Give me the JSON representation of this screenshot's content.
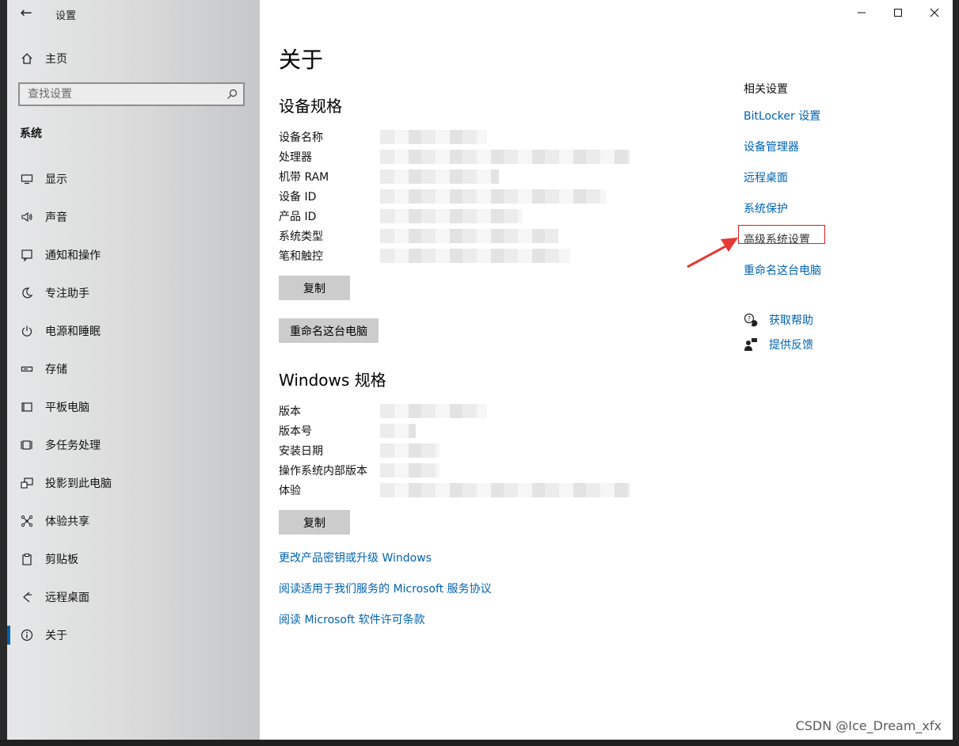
{
  "titlebar": {
    "title": "设置"
  },
  "sidebar": {
    "home_label": "主页",
    "search_placeholder": "查找设置",
    "section": "系统",
    "items": [
      {
        "label": "显示",
        "icon": "monitor-icon"
      },
      {
        "label": "声音",
        "icon": "speaker-icon"
      },
      {
        "label": "通知和操作",
        "icon": "notification-icon"
      },
      {
        "label": "专注助手",
        "icon": "moon-icon"
      },
      {
        "label": "电源和睡眠",
        "icon": "power-icon"
      },
      {
        "label": "存储",
        "icon": "storage-icon"
      },
      {
        "label": "平板电脑",
        "icon": "tablet-icon"
      },
      {
        "label": "多任务处理",
        "icon": "multitask-icon"
      },
      {
        "label": "投影到此电脑",
        "icon": "project-icon"
      },
      {
        "label": "体验共享",
        "icon": "share-icon"
      },
      {
        "label": "剪贴板",
        "icon": "clipboard-icon"
      },
      {
        "label": "远程桌面",
        "icon": "remote-icon"
      },
      {
        "label": "关于",
        "icon": "info-icon"
      }
    ],
    "active_index": 12
  },
  "main": {
    "title": "关于",
    "device_spec": {
      "heading": "设备规格",
      "rows": [
        {
          "label": "设备名称"
        },
        {
          "label": "处理器"
        },
        {
          "label": "机带 RAM"
        },
        {
          "label": "设备 ID"
        },
        {
          "label": "产品 ID"
        },
        {
          "label": "系统类型"
        },
        {
          "label": "笔和触控"
        }
      ],
      "copy_button": "复制",
      "rename_button": "重命名这台电脑"
    },
    "windows_spec": {
      "heading": "Windows 规格",
      "rows": [
        {
          "label": "版本"
        },
        {
          "label": "版本号"
        },
        {
          "label": "安装日期"
        },
        {
          "label": "操作系统内部版本"
        },
        {
          "label": "体验"
        }
      ],
      "copy_button": "复制"
    },
    "links": [
      "更改产品密钥或升级 Windows",
      "阅读适用于我们服务的 Microsoft 服务协议",
      "阅读 Microsoft 软件许可条款"
    ]
  },
  "related": {
    "title": "相关设置",
    "links": [
      "BitLocker 设置",
      "设备管理器",
      "远程桌面",
      "系统保护",
      "高级系统设置",
      "重命名这台电脑"
    ],
    "highlighted_index": 4
  },
  "help": {
    "items": [
      {
        "label": "获取帮助",
        "icon": "help-chat-icon"
      },
      {
        "label": "提供反馈",
        "icon": "feedback-icon"
      }
    ]
  },
  "watermark": "CSDN @Ice_Dream_xfx",
  "colors": {
    "accent": "#0063b1",
    "highlight": "#e02020"
  }
}
